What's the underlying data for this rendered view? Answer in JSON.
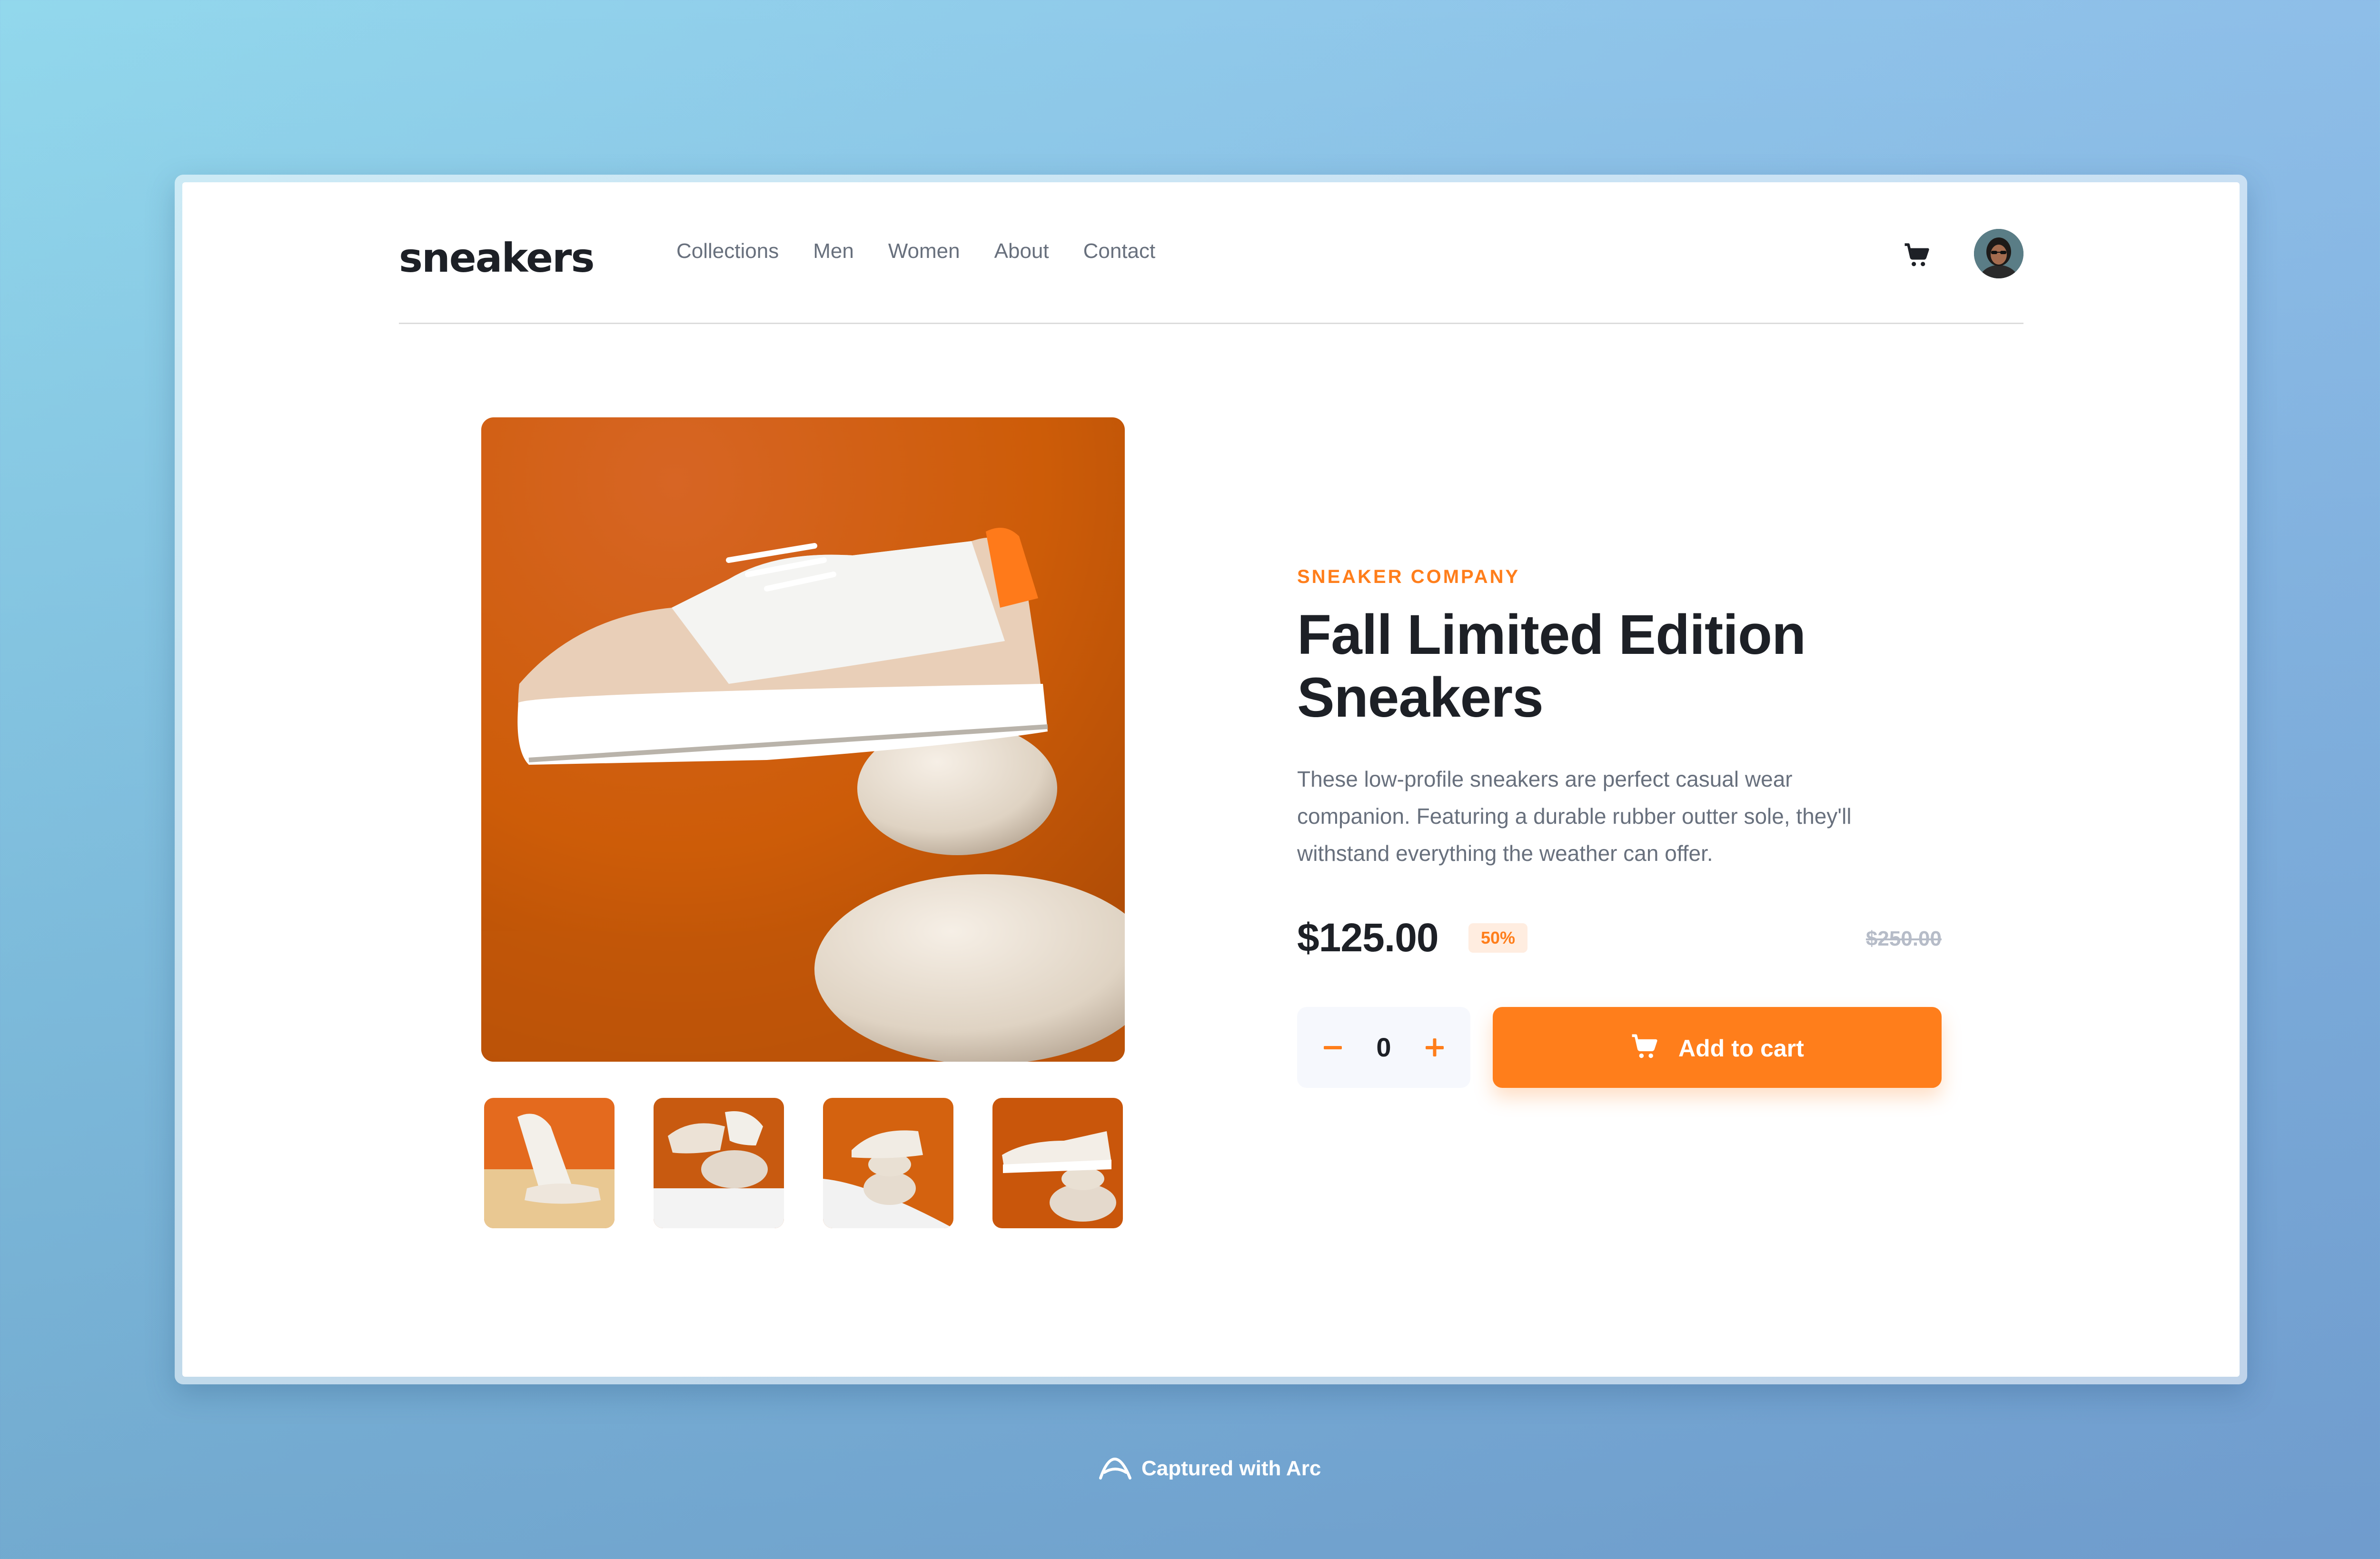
{
  "brand": {
    "logo_text": "sneakers",
    "accent_color": "#ff7e1b",
    "text_color": "#1d2026",
    "muted_color": "#68707d"
  },
  "nav": {
    "items": [
      {
        "label": "Collections"
      },
      {
        "label": "Men"
      },
      {
        "label": "Women"
      },
      {
        "label": "About"
      },
      {
        "label": "Contact"
      }
    ]
  },
  "header_icons": {
    "cart": "cart-icon",
    "avatar": "user-avatar"
  },
  "gallery": {
    "main_image": "sneaker-on-stones-photo",
    "thumbnails": [
      {
        "name": "thumbnail-1"
      },
      {
        "name": "thumbnail-2"
      },
      {
        "name": "thumbnail-3"
      },
      {
        "name": "thumbnail-4"
      }
    ]
  },
  "product": {
    "company": "SNEAKER COMPANY",
    "title_line1": "Fall Limited Edition",
    "title_line2": "Sneakers",
    "description": "These low-profile sneakers are perfect casual wear companion. Featuring a durable rubber outter sole, they'll withstand everything the weather can offer.",
    "description_lines": [
      "These low-profile sneakers are perfect casual wear",
      "companion. Featuring a durable rubber outter sole, they'll",
      "withstand everything the weather can offer."
    ],
    "price": "$125.00",
    "discount": "50%",
    "original_price": "$250.00"
  },
  "cart_controls": {
    "quantity": "0",
    "minus_icon": "minus-icon",
    "plus_icon": "plus-icon",
    "add_label": "Add to cart"
  },
  "footer": {
    "caption": "Captured with Arc"
  }
}
